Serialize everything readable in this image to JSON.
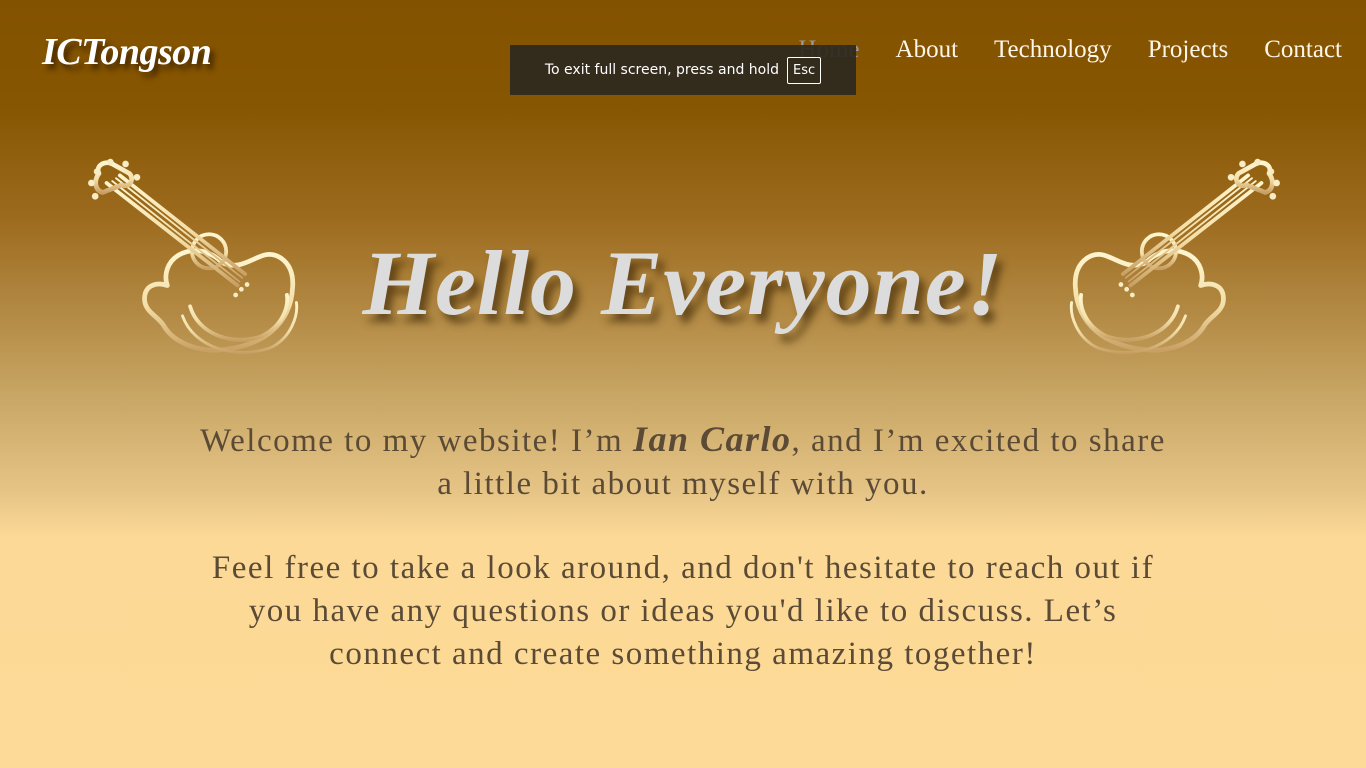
{
  "header": {
    "brand": "ICTongson",
    "nav": [
      {
        "label": "Home"
      },
      {
        "label": "About"
      },
      {
        "label": "Technology"
      },
      {
        "label": "Projects"
      },
      {
        "label": "Contact"
      }
    ]
  },
  "fullscreen_notice": {
    "text": "To exit full screen, press and hold",
    "key": "Esc"
  },
  "hero": {
    "title": "Hello Everyone!",
    "intro_before": "Welcome to my website! I’m ",
    "intro_name": "Ian Carlo",
    "intro_after": ", and I’m excited to share a little bit about myself with you.",
    "invite": "Feel free to take a look around, and don't hesitate to reach out if you have any questions or ideas you'd like to discuss. Let’s connect and create something amazing together!"
  },
  "icons": {
    "left": "guitar-icon",
    "right": "guitar-icon"
  },
  "colors": {
    "header_brown": "#835200",
    "page_cream": "#fdda97",
    "body_text": "#5b4b36",
    "title_silver": "#dcdcdc",
    "guitar_gold": "#f4e2b0"
  }
}
